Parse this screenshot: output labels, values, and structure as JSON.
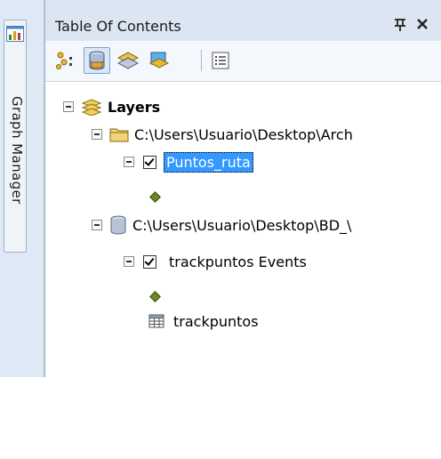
{
  "side_strip": {
    "tab_label": "Graph Manager",
    "tab_icon": "bar-chart-icon"
  },
  "panel": {
    "title": "Table Of Contents",
    "pin_label": "ᵖ",
    "close_label": "×"
  },
  "toolbar": {
    "buttons": [
      {
        "icon": "list-by-drawing-order-icon",
        "active": false
      },
      {
        "icon": "list-by-source-icon",
        "active": true
      },
      {
        "icon": "list-by-visibility-icon",
        "active": false
      },
      {
        "icon": "list-by-selection-icon",
        "active": false
      },
      {
        "icon": "options-icon",
        "active": false
      }
    ]
  },
  "tree": {
    "layers_label": "Layers",
    "folder_path": "C:\\Users\\Usuario\\Desktop\\Arch",
    "layer1_name": "Puntos_ruta",
    "layer1_checked": true,
    "database_path": "C:\\Users\\Usuario\\Desktop\\BD_\\",
    "layer2_name": "trackpuntos Events",
    "layer2_checked": true,
    "table_name": "trackpuntos",
    "symbol_color": "#6e8a1d",
    "selection_color": "#3399ff"
  }
}
